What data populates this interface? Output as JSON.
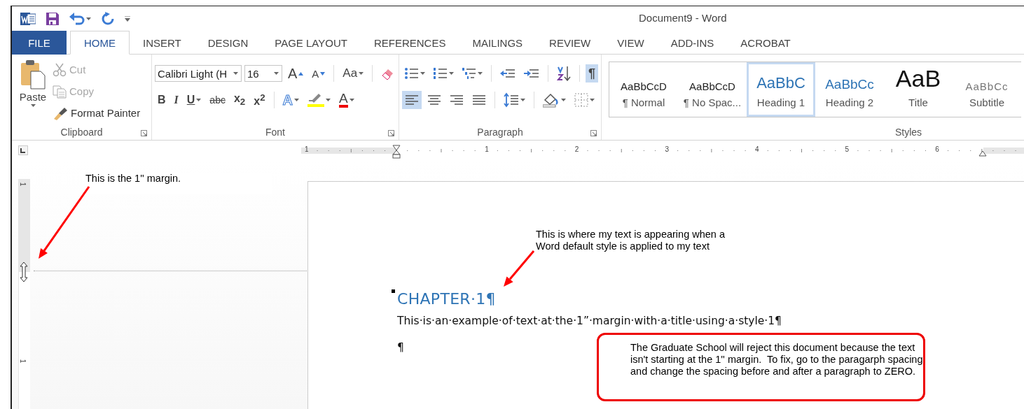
{
  "window": {
    "title": "Document9 - Word"
  },
  "tabs": [
    {
      "label": "FILE",
      "kind": "file",
      "selected": false
    },
    {
      "label": "HOME",
      "kind": "tab",
      "selected": true
    },
    {
      "label": "INSERT",
      "kind": "tab",
      "selected": false
    },
    {
      "label": "DESIGN",
      "kind": "tab",
      "selected": false
    },
    {
      "label": "PAGE LAYOUT",
      "kind": "tab",
      "selected": false
    },
    {
      "label": "REFERENCES",
      "kind": "tab",
      "selected": false
    },
    {
      "label": "MAILINGS",
      "kind": "tab",
      "selected": false
    },
    {
      "label": "REVIEW",
      "kind": "tab",
      "selected": false
    },
    {
      "label": "VIEW",
      "kind": "tab",
      "selected": false
    },
    {
      "label": "ADD-INS",
      "kind": "tab",
      "selected": false
    },
    {
      "label": "ACROBAT",
      "kind": "tab",
      "selected": false
    }
  ],
  "clipboard": {
    "name": "Clipboard",
    "paste": "Paste",
    "items": [
      {
        "kind": "cut",
        "label": "Cut",
        "disabled": true
      },
      {
        "kind": "copy",
        "label": "Copy",
        "disabled": true
      },
      {
        "kind": "painter",
        "label": "Format Painter",
        "disabled": false
      }
    ]
  },
  "font": {
    "name": "Font",
    "font_name": "Calibri Light (H",
    "font_size": "16",
    "row1": [
      {
        "kind": "grow",
        "label": "A"
      },
      {
        "kind": "shrink",
        "label": "A"
      },
      {
        "kind": "case",
        "label": "Aa"
      },
      {
        "kind": "clear"
      }
    ],
    "row2": [
      {
        "kind": "bold",
        "label": "B"
      },
      {
        "kind": "italic",
        "label": "I"
      },
      {
        "kind": "underline",
        "label": "U"
      },
      {
        "kind": "strike",
        "label": "abc"
      },
      {
        "kind": "sub",
        "label": "x$_{2}$"
      },
      {
        "kind": "sup",
        "label": "x$^{2}$"
      },
      {
        "kind": "effects",
        "label": "A"
      },
      {
        "kind": "highlight"
      },
      {
        "kind": "color",
        "label": "A"
      }
    ]
  },
  "paragraph": {
    "name": "Paragraph",
    "row1": [
      {
        "kind": "bullets"
      },
      {
        "kind": "numbering"
      },
      {
        "kind": "multilevel"
      },
      {
        "kind": "outdent"
      },
      {
        "kind": "indent"
      },
      {
        "kind": "sort"
      },
      {
        "kind": "marks",
        "label": "¶",
        "on": true
      }
    ],
    "alignment": [
      {
        "kind": "left",
        "selected": true
      },
      {
        "kind": "center",
        "selected": false
      },
      {
        "kind": "right",
        "selected": false
      },
      {
        "kind": "justify",
        "selected": false
      }
    ],
    "row2": [
      {
        "kind": "spacing"
      },
      {
        "kind": "shading"
      },
      {
        "kind": "borders"
      }
    ]
  },
  "styles": {
    "name": "Styles",
    "items": [
      {
        "kind": "normal",
        "preview": "AaBbCcD",
        "label": "¶ Normal",
        "selected": false
      },
      {
        "kind": "normal",
        "preview": "AaBbCcD",
        "label": "¶ No Spac...",
        "selected": false
      },
      {
        "kind": "heading1",
        "preview": "AaBbC",
        "label": "Heading 1",
        "selected": true
      },
      {
        "kind": "heading2",
        "preview": "AaBbCc",
        "label": "Heading 2",
        "selected": false
      },
      {
        "kind": "title",
        "preview": "AaB",
        "label": "Title",
        "selected": false
      },
      {
        "kind": "subtitle",
        "preview": "AaBbCc",
        "label": "Subtitle",
        "selected": false
      }
    ]
  },
  "ruler": {
    "labels": [
      "1",
      "1",
      "2",
      "3",
      "4",
      "5",
      "6"
    ]
  },
  "vertical_ruler": {
    "labels": [
      "1",
      "1"
    ]
  },
  "document": {
    "heading": "CHAPTER·1¶",
    "paragraphs": [
      "This·is·an·example·of·text·at·the·1”·margin·with·a·title·using·a·style·1¶",
      "¶"
    ]
  },
  "annotations": [
    {
      "kind": "note",
      "text": "This is the 1'' margin."
    },
    {
      "kind": "note",
      "text": "This is where my text is appearing when a Word default style is applied to my text"
    },
    {
      "kind": "box",
      "text": "The Graduate School will reject this document because the text isn't starting at the 1'' margin.  To fix, go to the paragarph spacing and change the spacing before and after a paragraph to ZERO."
    }
  ]
}
